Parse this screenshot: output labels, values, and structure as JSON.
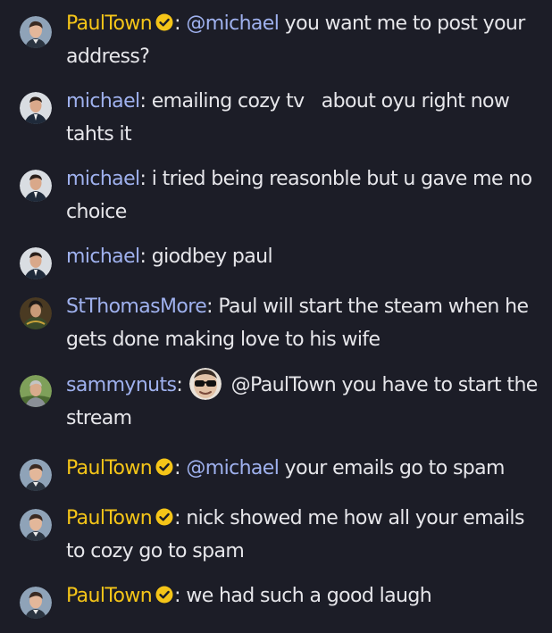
{
  "messages": [
    {
      "username": "PaulTown",
      "verified": true,
      "colon": ":",
      "mention": "@michael",
      "text": " you want me to post your address?",
      "avatar_icon": "paultown-avatar-icon"
    },
    {
      "username": "michael",
      "verified": false,
      "colon": ":",
      "text": " emailing cozy tv   about oyu right now tahts it",
      "avatar_icon": "michael-avatar-icon"
    },
    {
      "username": "michael",
      "verified": false,
      "colon": ":",
      "text": " i tried being reasonble but u gave me no choice",
      "avatar_icon": "michael-avatar-icon"
    },
    {
      "username": "michael",
      "verified": false,
      "colon": ":",
      "text": " giodbey paul",
      "avatar_icon": "michael-avatar-icon"
    },
    {
      "username": "StThomasMore",
      "verified": false,
      "colon": ":",
      "text": " Paul will start the steam when he gets done making love to his wife",
      "avatar_icon": "stthomasmore-avatar-icon"
    },
    {
      "username": "sammynuts",
      "verified": false,
      "colon": ":",
      "text": " @PaulTown you have to start the stream",
      "avatar_icon": "sammynuts-avatar-icon",
      "emote_icon": "sunglasses-face-emote-icon"
    },
    {
      "username": "PaulTown",
      "verified": true,
      "colon": ":",
      "mention": "@michael",
      "text": " your emails go to spam",
      "avatar_icon": "paultown-avatar-icon"
    },
    {
      "username": "PaulTown",
      "verified": true,
      "colon": ":",
      "text": " nick showed me how all your emails to cozy go to spam",
      "avatar_icon": "paultown-avatar-icon"
    },
    {
      "username": "PaulTown",
      "verified": true,
      "colon": ":",
      "text": " we had such a good laugh",
      "avatar_icon": "paultown-avatar-icon"
    }
  ],
  "colors": {
    "background": "#1c1d27",
    "verified_name": "#f5c518",
    "username": "#9fb1ee",
    "mention": "#9fb1ee",
    "text": "#e6e6ea",
    "verified_badge": "#f5c518"
  }
}
